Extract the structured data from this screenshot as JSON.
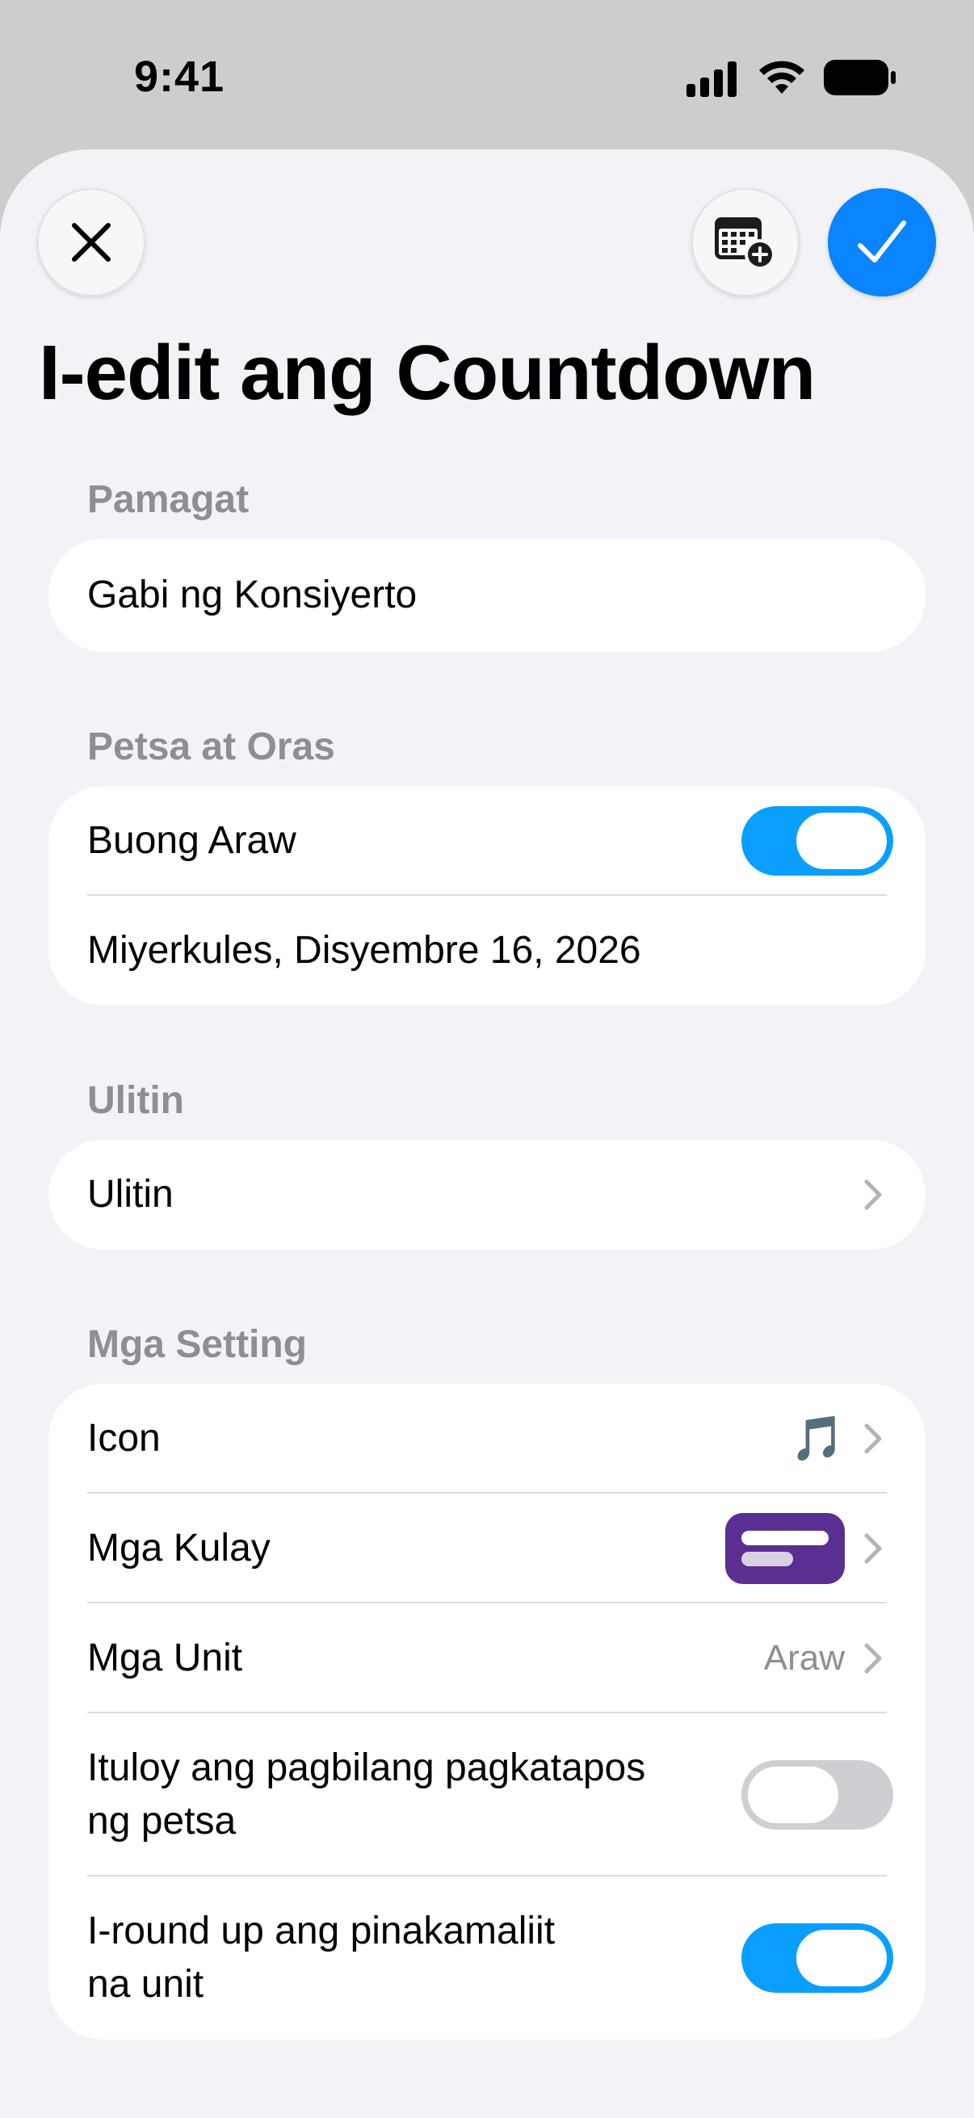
{
  "status_bar": {
    "time": "9:41"
  },
  "toolbar": {
    "close_icon": "xmark-icon",
    "calendar_icon": "calendar-plus-icon",
    "done_icon": "checkmark-icon"
  },
  "page_title": "I-edit ang Countdown",
  "sections": {
    "title": {
      "header": "Pamagat",
      "value": "Gabi ng Konsiyerto"
    },
    "date_time": {
      "header": "Petsa at Oras",
      "all_day_label": "Buong Araw",
      "all_day_on": true,
      "date_value": "Miyerkules, Disyembre 16, 2026"
    },
    "repeat": {
      "header": "Ulitin",
      "row_label": "Ulitin"
    },
    "settings": {
      "header": "Mga Setting",
      "icon_label": "Icon",
      "icon_value": "🎵",
      "colors_label": "Mga Kulay",
      "color_swatch": "#5b2e91",
      "units_label": "Mga Unit",
      "units_value": "Araw",
      "continue_label_line1": "Ituloy ang pagbilang pagkatapos",
      "continue_label_line2": "ng petsa",
      "continue_on": false,
      "roundup_label_line1": "I-round up ang pinakamaliit",
      "roundup_label_line2": "na unit",
      "roundup_on": true
    }
  },
  "colors": {
    "accent": "#0a84ff",
    "toggle_on": "#0a9fff",
    "secondary_text": "#8e8e93",
    "background": "#f2f2f7"
  }
}
